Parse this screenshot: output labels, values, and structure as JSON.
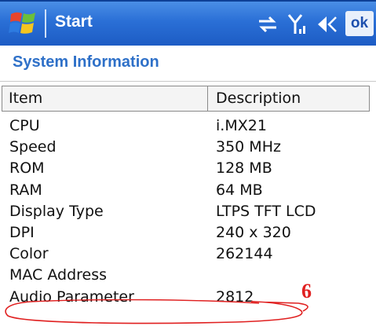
{
  "titlebar": {
    "app_title": "Start",
    "ok_label": "ok",
    "icons": [
      "windows-flag-icon",
      "connectivity-icon",
      "signal-icon",
      "speaker-icon"
    ]
  },
  "page": {
    "title": "System Information"
  },
  "table": {
    "columns": [
      "Item",
      "Description"
    ],
    "rows": [
      {
        "item": "CPU",
        "description": "i.MX21"
      },
      {
        "item": "Speed",
        "description": "350 MHz"
      },
      {
        "item": "ROM",
        "description": "128 MB"
      },
      {
        "item": "RAM",
        "description": "64 MB"
      },
      {
        "item": "Display Type",
        "description": "LTPS TFT LCD"
      },
      {
        "item": "DPI",
        "description": "240 x 320"
      },
      {
        "item": "Color",
        "description": "262144"
      },
      {
        "item": "MAC Address",
        "description": ""
      },
      {
        "item": "Audio Parameter",
        "description": "2812"
      }
    ]
  },
  "annotation": {
    "label": "6",
    "color": "#e02020"
  },
  "colors": {
    "titlebar": "#2a6fd6",
    "page_title": "#2e70c8"
  }
}
